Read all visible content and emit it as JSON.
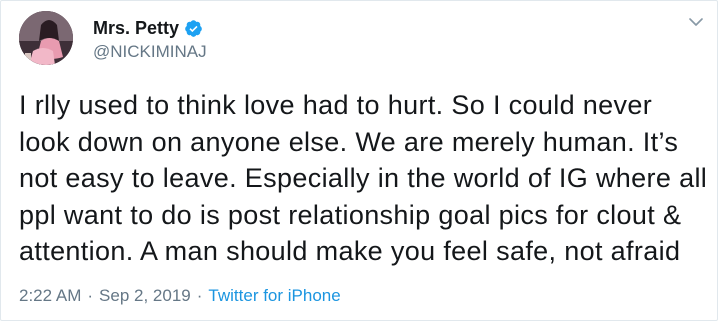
{
  "tweet": {
    "author": {
      "display_name": "Mrs. Petty",
      "handle": "@NICKIMINAJ",
      "verified": true
    },
    "text_lines": [
      "I rlly used to think love had to hurt. So I could never",
      "look down on anyone else. We are merely human. It’s",
      "not easy to leave. Especially in the world of IG where all",
      "ppl want to do is post relationship goal pics for clout &",
      "attention. A man should make you feel safe, not afraid"
    ],
    "time": "2:22 AM",
    "separator": "·",
    "date": "Sep 2, 2019",
    "source": "Twitter for iPhone"
  },
  "icons": {
    "verified": "verified-badge-icon",
    "more": "chevron-down-icon"
  },
  "colors": {
    "primary_text": "#14171a",
    "secondary_text": "#657786",
    "link": "#1b95e0",
    "verified_badge": "#1da1f2",
    "border": "#e1e8ed"
  }
}
